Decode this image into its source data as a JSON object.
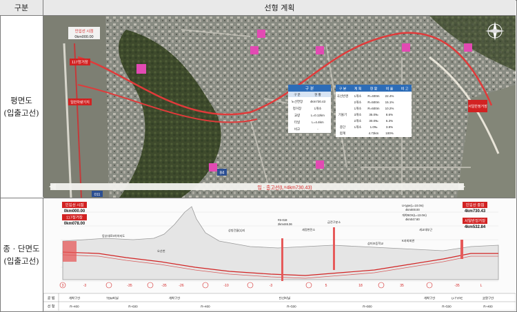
{
  "header": {
    "col1": "구분",
    "col2": "선형 계획"
  },
  "rows": {
    "plan": {
      "label1": "평면도",
      "label2": "(입출고선)"
    },
    "profile": {
      "label1": "종 · 단면도",
      "label2": "(입출고선)"
    }
  },
  "plan": {
    "start_station": "0km000.00",
    "start_label": "인입선 시점",
    "station_117": "117정거장",
    "yard": "일반차량기지",
    "bridge_label": "입 · 출고선(L=4km730.43)",
    "route_no": "84",
    "route_no2": "011",
    "sign_end": "서일반정거장",
    "legend_title": "도시계획",
    "table1": {
      "title": "구 분",
      "headers": [
        "구 분",
        "현 황"
      ],
      "rows": [
        [
          "노선연장",
          "4km730.43"
        ],
        [
          "정거장",
          "1개소"
        ],
        [
          "교량",
          "L=0.12km"
        ],
        [
          "터널",
          "L=4.4km"
        ],
        [
          "비고",
          "-"
        ]
      ]
    },
    "table2": {
      "headers": [
        "구 분",
        "계 획",
        "현 황",
        "비 율",
        "비 고"
      ],
      "rows": [
        [
          "곡선반경",
          "1개소",
          "R=400m",
          "22.4%",
          ""
        ],
        [
          "",
          "2개소",
          "R=500m",
          "15.1%",
          ""
        ],
        [
          "",
          "1개소",
          "R=600m",
          "10.2%",
          ""
        ],
        [
          "기울기",
          "3개소",
          "35.0‰",
          "8.6%",
          ""
        ],
        [
          "",
          "2개소",
          "30.0‰",
          "6.3%",
          ""
        ],
        [
          "종단",
          "1개소",
          "1.0‰",
          "3.8%",
          ""
        ],
        [
          "합계",
          "",
          "4.73km",
          "100%",
          ""
        ]
      ]
    }
  },
  "profile": {
    "start_title": "인입선 시점",
    "start_sta": "0km000.00",
    "st117": "117정거장",
    "st117_sta": "0km078.00",
    "end_title": "인입선 종점",
    "end_sta": "4km730.43",
    "seoil": "서일반정거장",
    "seoil_sta": "4km532.84",
    "labels": {
      "river": "동부대로3차하지도",
      "ohseon": "오산천",
      "tunnel": "상방건물(1)지",
      "sta_mid": "#S-019",
      "sta_mid2": "2km446.36",
      "vent": "세정변전소",
      "cross": "급전구분소",
      "school": "삼미초등학교",
      "hall": "K과외회관",
      "park": "세교대부근",
      "u_type": "U-type(L=10.0m)",
      "u_sta": "4km000.00",
      "open": "개착BOX(L=13.0m)",
      "open_sta": "4km047.80"
    },
    "grades": [
      "3",
      "-3",
      "-35",
      "-35",
      "-26",
      "-10",
      "-3",
      "5",
      "18",
      "35",
      "-35",
      "L"
    ],
    "table_rows": {
      "r1": "공 법",
      "r2": "선 형",
      "r1_items": [
        "개착구간",
        "TBM터널",
        "개착구간",
        "단선터널",
        "개착구간",
        "U-TYPE",
        "교량구간"
      ],
      "r2_items": [
        "R=400",
        "R=600",
        "R=400",
        "R=500",
        "R=800",
        "R=500",
        "R=400"
      ]
    }
  }
}
